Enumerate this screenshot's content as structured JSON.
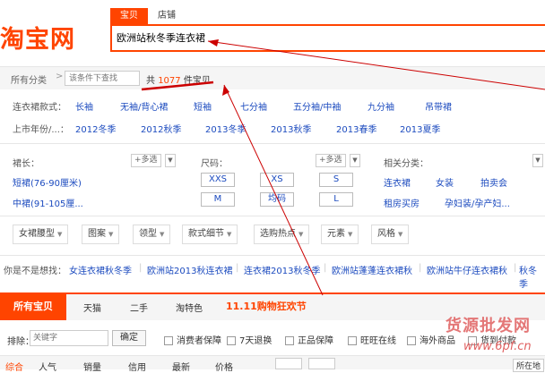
{
  "header": {
    "logo": "淘宝网",
    "tab_baobei": "宝贝",
    "tab_shop": "店铺",
    "search_value": "欧洲站秋冬季连衣裙"
  },
  "filter_bar": {
    "all_categories": "所有分类",
    "arrow": ">",
    "condition_placeholder": "该条件下查找",
    "count_prefix": "共",
    "count_number": "1077",
    "count_suffix": "件宝贝"
  },
  "sleeve_row": {
    "label": "连衣裙款式：",
    "items": [
      "长袖",
      "无袖/背心裙",
      "短袖",
      "七分袖",
      "五分袖/中袖",
      "九分袖",
      "吊带裙"
    ]
  },
  "year_row": {
    "label": "上市年份/...：",
    "items": [
      "2012冬季",
      "2012秋季",
      "2013冬季",
      "2013秋季",
      "2013春季",
      "2013夏季"
    ]
  },
  "skirt_length": {
    "label": "裙长：",
    "multi": "+多选",
    "items": [
      "短裙(76-90厘米)",
      "中裙(91-105厘..."
    ]
  },
  "size": {
    "label": "尺码：",
    "multi": "+多选",
    "items": [
      "XXS",
      "XS",
      "S",
      "M",
      "均码",
      "L"
    ]
  },
  "related": {
    "label": "相关分类：",
    "items": [
      "连衣裙",
      "女装",
      "拍卖会",
      "租房买房",
      "孕妇装/孕产妇..."
    ]
  },
  "dropdowns": [
    "女裙腰型",
    "图案",
    "领型",
    "款式细节",
    "选购热点",
    "元素",
    "风格"
  ],
  "suggest": {
    "label": "你是不是想找：",
    "items": [
      "女连衣裙秋冬季",
      "欧洲站2013秋连衣裙",
      "连衣裙2013秋冬季",
      "欧洲站蓬蓬连衣裙秋",
      "欧洲站牛仔连衣裙秋",
      "秋冬季"
    ]
  },
  "tabs": {
    "all": "所有宝贝",
    "items": [
      "天猫",
      "二手",
      "淘特色"
    ],
    "promo": "11.11购物狂欢节"
  },
  "exclude": {
    "label": "排除：",
    "placeholder": "关键字",
    "confirm": "确定"
  },
  "checkboxes": [
    "消费者保障",
    "7天退换",
    "正品保障",
    "旺旺在线",
    "海外商品",
    "货到付款"
  ],
  "sort": [
    "综合",
    "人气",
    "销量",
    "信用",
    "最新",
    "价格"
  ],
  "location": "所在地",
  "watermark": "货源批发网",
  "watermark_url": "www.6pf.cn",
  "colors": {
    "accent": "#ff4400",
    "link": "#1c4bbf",
    "annotation": "#cc0000"
  }
}
